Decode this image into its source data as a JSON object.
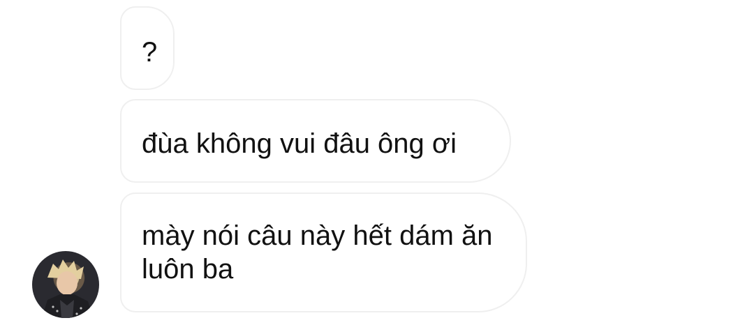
{
  "messages": [
    {
      "text": "?"
    },
    {
      "text": "đùa không vui đâu ông ơi"
    },
    {
      "text": "mày nói câu này hết dám ăn luôn ba"
    }
  ],
  "avatar": {
    "icon": "user-avatar-photo"
  },
  "colors": {
    "background": "#ffffff",
    "bubble_border": "#efefef",
    "text": "#111111"
  }
}
